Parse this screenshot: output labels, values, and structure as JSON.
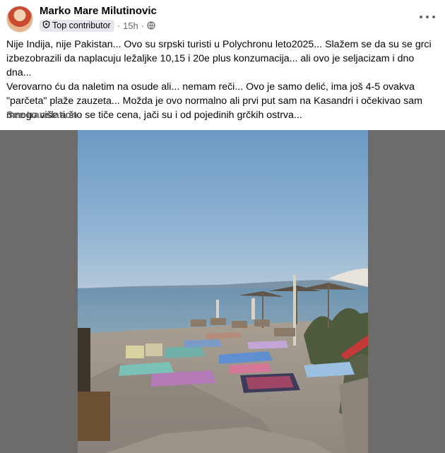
{
  "post": {
    "author": "Marko Mare Milutinovic",
    "badge": "Top contributor",
    "separator": "·",
    "time": "15h",
    "text": "Nije Indija, nije Pakistan... Ovo su srpski turisti u Polychronu leto2025... Slažem se da su se grci\nizbezobrazili da naplacuju ležaljke 10,15 i 20e plus konzumacija... ali ovo je seljacizam i dno dna...\nVerovarno ću da naletim na osude ali... nemam reči... Ovo je samo delić, ima još 4-5 ovakva\n\"parčeta\" plaže zauzeta... Možda je ovo normalno ali prvi put sam na Kasandri i očekivao sam\nmnogo više a što se tiče cena, jači su i od pojedinih grčkih ostrva...",
    "see_translation": "See translation"
  },
  "icons": {
    "badge": "contributor-shield-icon",
    "privacy": "globe-icon",
    "menu": "more-options-icon"
  },
  "colors": {
    "text_primary": "#050505",
    "text_secondary": "#65676b",
    "badge_bg": "#e4e6eb",
    "media_bg": "#6e6c6a"
  }
}
